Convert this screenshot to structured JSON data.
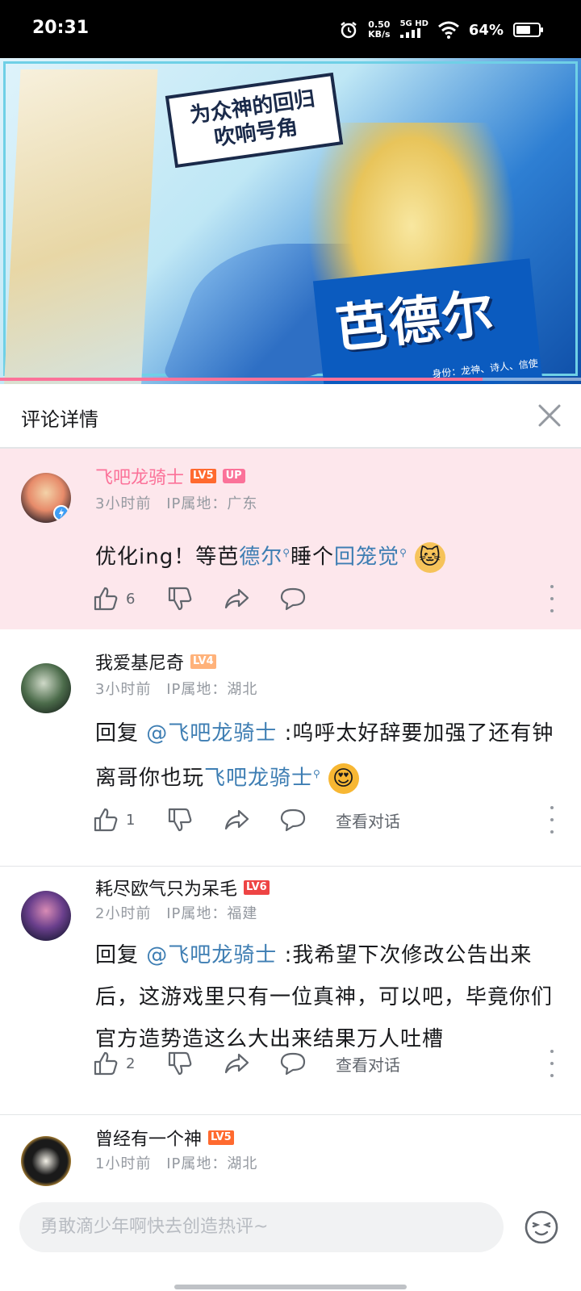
{
  "status_bar": {
    "time": "20:31",
    "net_speed_top": "0.50",
    "net_speed_unit": "KB/s",
    "net_type_top": "5G HD",
    "battery": "64%",
    "battery_level": 0.64
  },
  "video": {
    "banner_line1": "为众神的回归",
    "banner_line2": "吹响号角",
    "character_name": "芭德尔",
    "character_sub": "身份：龙神、诗人、信使",
    "progress": 0.83,
    "progress_color": "#fb7299"
  },
  "header": {
    "title": "评论详情",
    "close_icon": "close-icon"
  },
  "comments": [
    {
      "username": "飞吧龙骑士",
      "level": "LV5",
      "level_color": "#ff6a2f",
      "badge": "UP",
      "time": "3小时前",
      "ip": "IP属地：广东",
      "content_parts": [
        "优化ing！等芭",
        "德尔",
        "睡个",
        "回笼觉"
      ],
      "emoji": "🐱",
      "likes": "6"
    },
    {
      "username": "我爱基尼奇",
      "level": "LV4",
      "level_color": "#ffb27a",
      "time": "3小时前",
      "ip": "IP属地：湖北",
      "reply_prefix": "回复",
      "reply_target": "@飞吧龙骑士",
      "content_parts": [
        ":呜呼太好辞要加强了还有钟离哥你也玩",
        "飞吧龙骑士"
      ],
      "emoji": "😍",
      "likes": "1",
      "view_dialog": "查看对话"
    },
    {
      "username": "耗尽欧气只为呆毛",
      "level": "LV6",
      "level_color": "#ee4444",
      "time": "2小时前",
      "ip": "IP属地：福建",
      "reply_prefix": "回复",
      "reply_target": "@飞吧龙骑士",
      "content_parts": [
        ":我希望下次修改公告出来后，这游戏里只有一位真神，可以吧，毕竟你们官方造势造这么大出来结果万人吐槽"
      ],
      "likes": "2",
      "view_dialog": "查看对话"
    },
    {
      "username": "曾经有一个神",
      "level": "LV5",
      "level_color": "#ff6a2f",
      "time": "1小时前",
      "ip": "IP属地：湖北"
    }
  ],
  "bottom": {
    "input_placeholder": "勇敢滴少年啊快去创造热评~"
  }
}
